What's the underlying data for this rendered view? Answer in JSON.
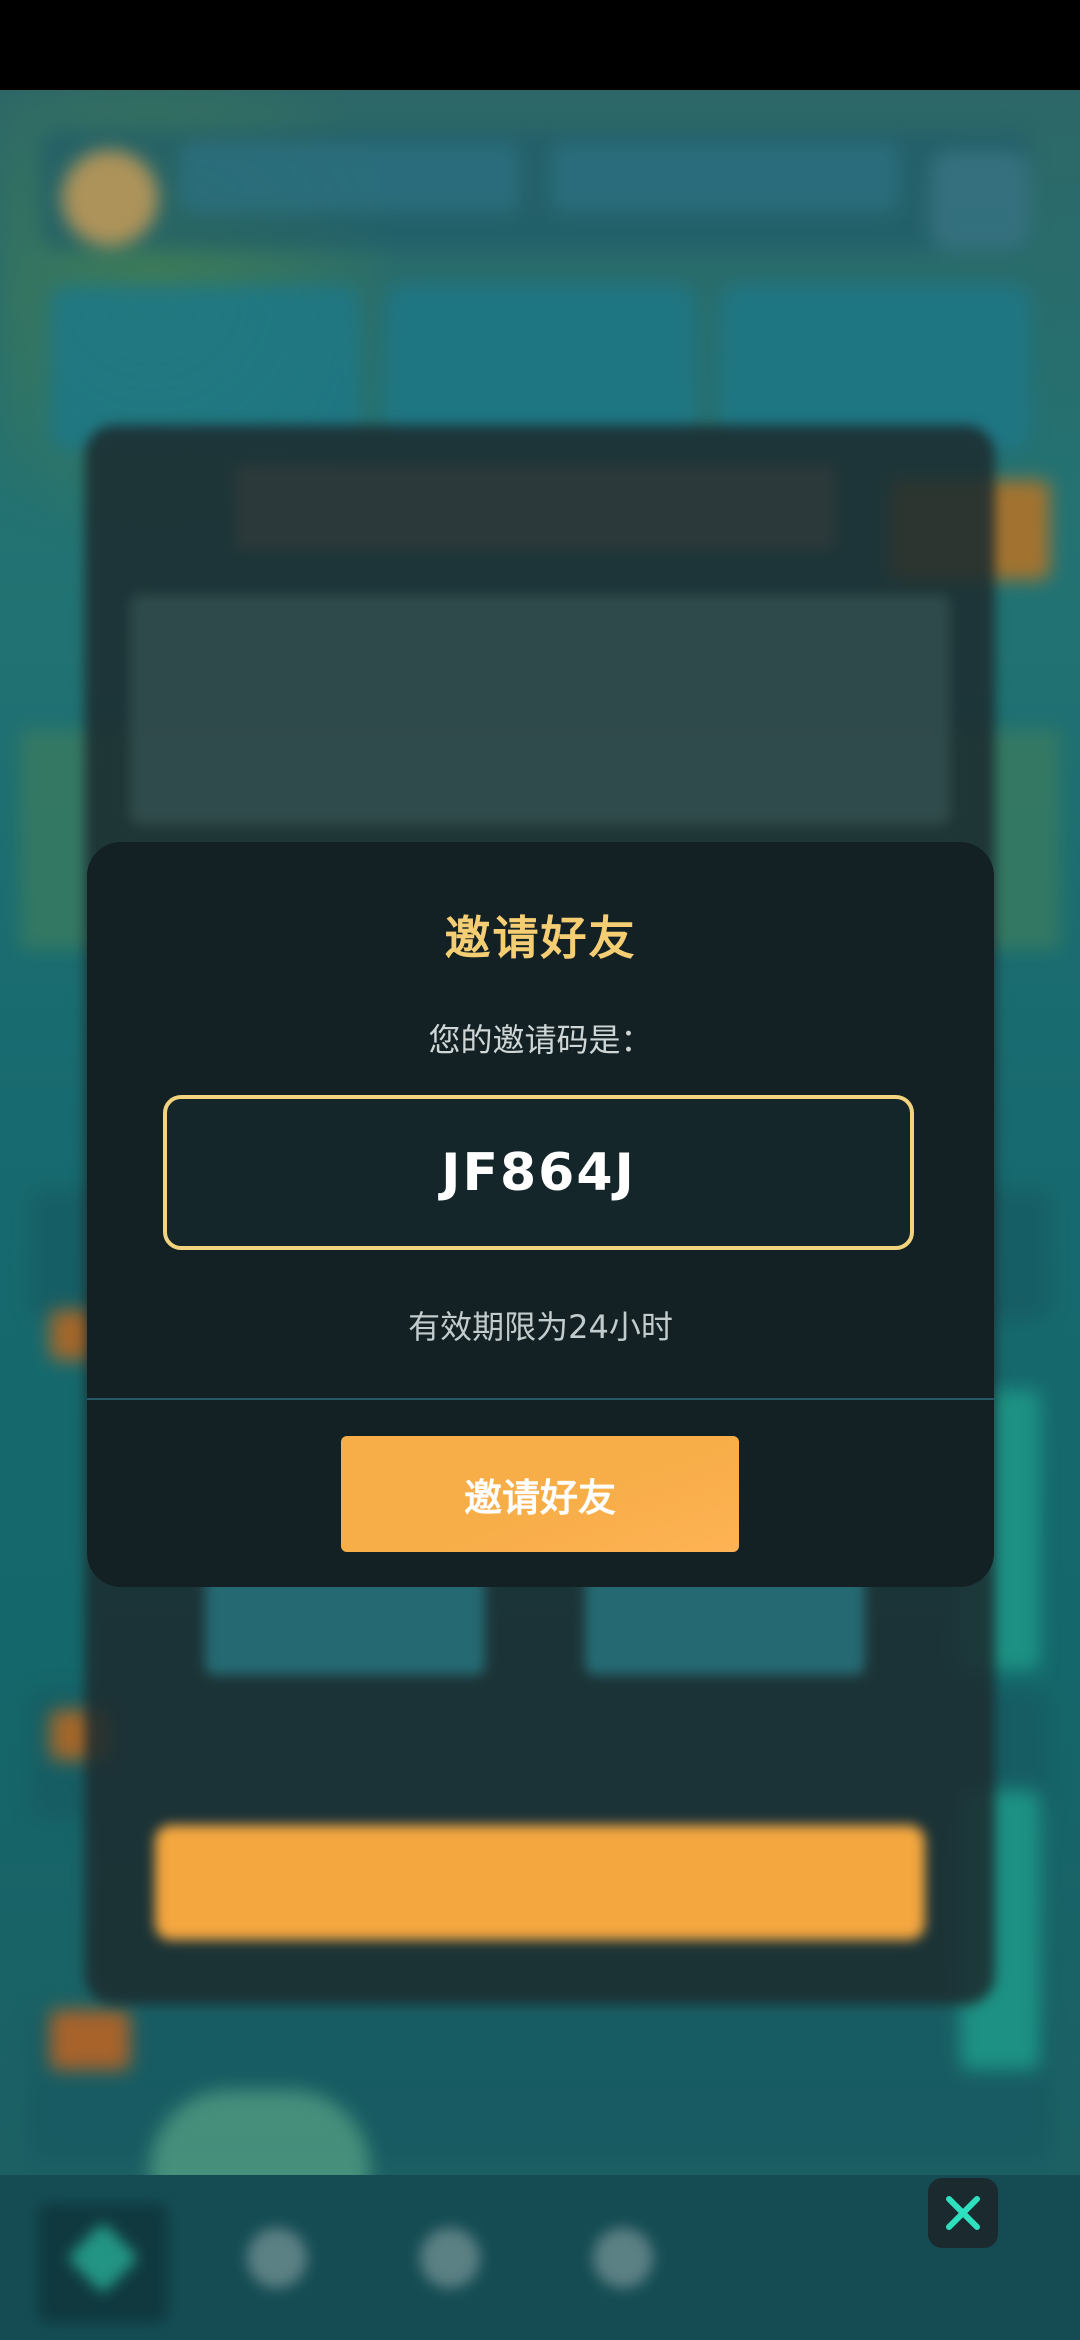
{
  "dialog": {
    "title": "邀请好友",
    "subtitle": "您的邀请码是：",
    "invite_code": "JF864J",
    "expiry_note": "有效期限为24小时",
    "invite_button_label": "邀请好友"
  },
  "colors": {
    "title": "#f5cd72",
    "code_border": "#f2d37e",
    "button": "#f7ad48",
    "modal_bg": "#142124"
  },
  "icons": {
    "close": "close-icon",
    "nav": [
      "home-icon",
      "shield-icon",
      "compass-icon",
      "heart-icon"
    ]
  }
}
